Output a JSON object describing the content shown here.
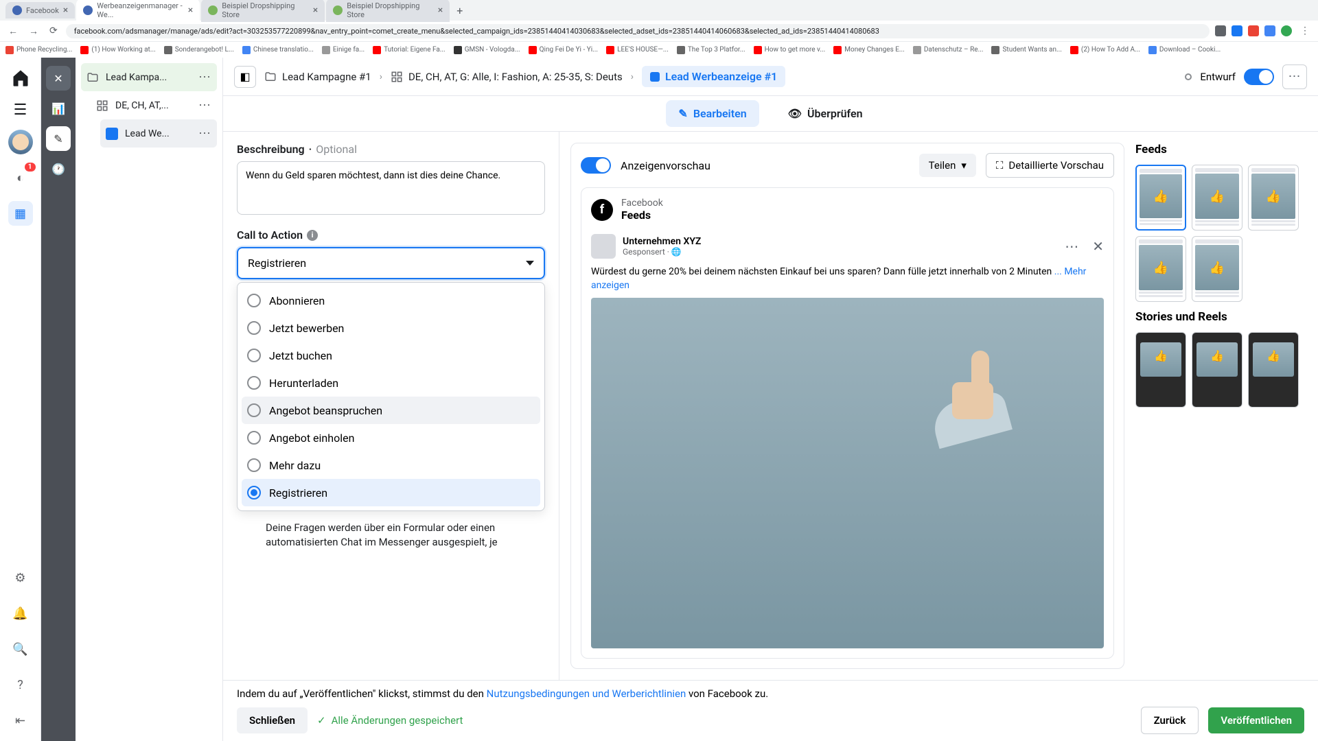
{
  "browser": {
    "tabs": [
      "Facebook",
      "Werbeanzeigenmanager - We...",
      "Beispiel Dropshipping Store",
      "Beispiel Dropshipping Store"
    ],
    "url": "facebook.com/adsmanager/manage/ads/edit?act=303253577220899&nav_entry_point=comet_create_menu&selected_campaign_ids=23851440414030683&selected_adset_ids=23851440414060683&selected_ad_ids=23851440414080683",
    "bookmarks": [
      "Phone Recycling...",
      "(1) How Working at...",
      "Sonderangebot! L...",
      "Chinese translatio...",
      "Einige fa...",
      "Tutorial: Eigene Fa...",
      "GMSN - Vologda...",
      "Qing Fei De Yi - Yi...",
      "LEE'S HOUSE—...",
      "The Top 3 Platfor...",
      "How to get more v...",
      "Money Changes E...",
      "Datenschutz – Re...",
      "Student Wants an...",
      "(2) How To Add A...",
      "Download – Cooki..."
    ]
  },
  "fb_rail": {
    "badge": "1"
  },
  "tree": {
    "campaign": "Lead Kampa...",
    "adset": "DE, CH, AT,...",
    "ad": "Lead We..."
  },
  "crumbs": {
    "campaign": "Lead Kampagne #1",
    "adset": "DE, CH, AT, G: Alle, I: Fashion, A: 25-35, S: Deuts",
    "ad": "Lead Werbeanzeige #1",
    "status": "Entwurf"
  },
  "tabs": {
    "edit": "Bearbeiten",
    "review": "Überprüfen"
  },
  "form": {
    "desc_label": "Beschreibung",
    "optional": "Optional",
    "desc_value": "Wenn du Geld sparen möchtest, dann ist dies deine Chance.",
    "cta_label": "Call to Action",
    "cta_selected": "Registrieren",
    "options": [
      "Abonnieren",
      "Jetzt bewerben",
      "Jetzt buchen",
      "Herunterladen",
      "Angebot beanspruchen",
      "Angebot einholen",
      "Mehr dazu",
      "Registrieren"
    ],
    "under": "Deine Fragen werden über ein Formular oder einen automatisierten Chat im Messenger ausgespielt, je"
  },
  "preview": {
    "title": "Anzeigenvorschau",
    "share": "Teilen",
    "detail": "Detaillierte Vorschau",
    "platform": "Facebook",
    "surface": "Feeds",
    "advertiser": "Unternehmen XYZ",
    "sponsored": "Gesponsert",
    "text": "Würdest du gerne 20% bei deinem nächsten Einkauf bei uns sparen? Dann fülle jetzt innerhalb von 2 Minuten",
    "more": "... Mehr anzeigen",
    "side_feeds": "Feeds",
    "side_stories": "Stories und Reels"
  },
  "footer": {
    "pre": "Indem du auf „Veröffentlichen\" klickst, stimmst du den ",
    "link": "Nutzungsbedingungen und Werberichtlinien",
    "post": " von Facebook zu.",
    "close": "Schließen",
    "saved": "Alle Änderungen gespeichert",
    "back": "Zurück",
    "publish": "Veröffentlichen"
  }
}
